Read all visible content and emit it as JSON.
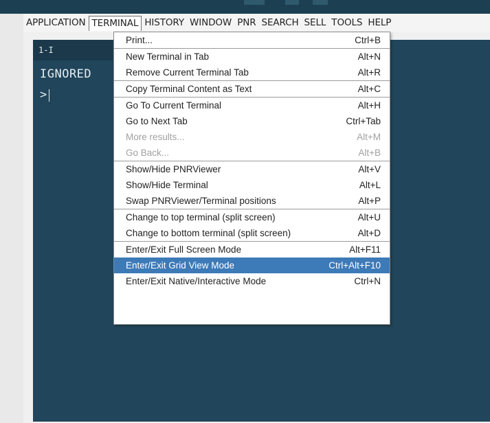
{
  "menubar": {
    "items": [
      {
        "label": "APPLICATION",
        "active": false
      },
      {
        "label": "TERMINAL",
        "active": true
      },
      {
        "label": "HISTORY",
        "active": false
      },
      {
        "label": "WINDOW",
        "active": false
      },
      {
        "label": "PNR",
        "active": false
      },
      {
        "label": "SEARCH",
        "active": false
      },
      {
        "label": "SELL",
        "active": false
      },
      {
        "label": "TOOLS",
        "active": false
      },
      {
        "label": "HELP",
        "active": false
      }
    ]
  },
  "terminal": {
    "tab_label": "1-I",
    "line1": "IGNORED",
    "prompt": ">"
  },
  "dropdown": {
    "groups": [
      [
        {
          "label": "Print...",
          "shortcut": "Ctrl+B",
          "enabled": true
        }
      ],
      [
        {
          "label": "New Terminal in Tab",
          "shortcut": "Alt+N",
          "enabled": true
        },
        {
          "label": "Remove Current Terminal Tab",
          "shortcut": "Alt+R",
          "enabled": true
        }
      ],
      [
        {
          "label": "Copy Terminal Content as Text",
          "shortcut": "Alt+C",
          "enabled": true
        }
      ],
      [
        {
          "label": "Go To Current Terminal",
          "shortcut": "Alt+H",
          "enabled": true
        },
        {
          "label": "Go to Next Tab",
          "shortcut": "Ctrl+Tab",
          "enabled": true
        },
        {
          "label": "More results...",
          "shortcut": "Alt+M",
          "enabled": false
        },
        {
          "label": "Go Back...",
          "shortcut": "Alt+B",
          "enabled": false
        }
      ],
      [
        {
          "label": "Show/Hide PNRViewer",
          "shortcut": "Alt+V",
          "enabled": true
        },
        {
          "label": "Show/Hide Terminal",
          "shortcut": "Alt+L",
          "enabled": true
        },
        {
          "label": "Swap PNRViewer/Terminal positions",
          "shortcut": "Alt+P",
          "enabled": true
        }
      ],
      [
        {
          "label": "Change to top terminal (split screen)",
          "shortcut": "Alt+U",
          "enabled": true
        },
        {
          "label": "Change to bottom terminal (split screen)",
          "shortcut": "Alt+D",
          "enabled": true
        }
      ],
      [
        {
          "label": "Enter/Exit Full Screen Mode",
          "shortcut": "Alt+F11",
          "enabled": true
        },
        {
          "label": "Enter/Exit Grid View Mode",
          "shortcut": "Ctrl+Alt+F10",
          "enabled": true,
          "highlighted": true
        },
        {
          "label": "Enter/Exit Native/Interactive Mode",
          "shortcut": "Ctrl+N",
          "enabled": true
        }
      ]
    ]
  },
  "colors": {
    "terminal_bg": "#21455a",
    "highlight": "#3d7ab8",
    "disabled_text": "#a0a0a0"
  }
}
